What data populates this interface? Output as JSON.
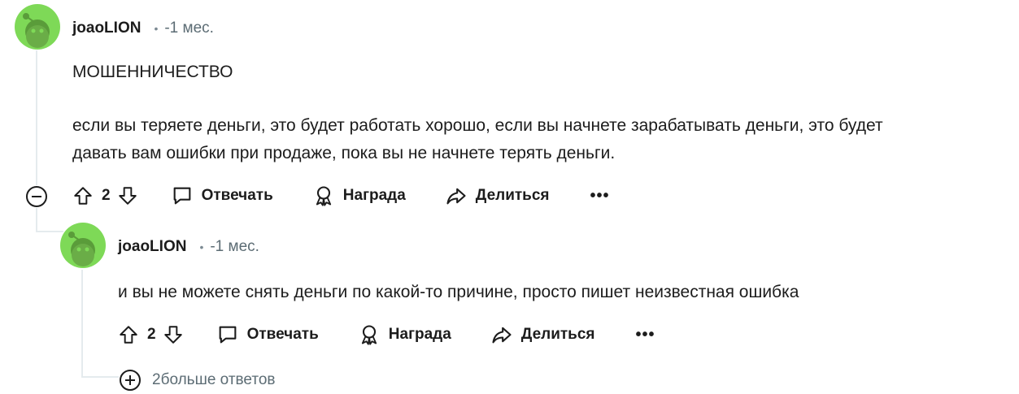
{
  "comments": [
    {
      "username": "joaoLION",
      "separator": "•",
      "time": "-1 мес.",
      "paragraphs": [
        "МОШЕННИЧЕСТВО",
        "если вы теряете деньги, это будет работать хорошо, если вы начнете зарабатывать деньги, это будет",
        "давать вам ошибки при продаже, пока вы не начнете терять деньги."
      ],
      "votes": "2",
      "actions": {
        "reply": "Отвечать",
        "award": "Награда",
        "share": "Делиться",
        "more": "•••"
      }
    },
    {
      "username": "joaoLION",
      "separator": "•",
      "time": "-1 мес.",
      "paragraphs": [
        "и вы не можете снять деньги по какой-то причине, просто пишет неизвестная ошибка"
      ],
      "votes": "2",
      "actions": {
        "reply": "Отвечать",
        "award": "Награда",
        "share": "Делиться",
        "more": "•••"
      }
    }
  ],
  "more_replies": "2больше ответов",
  "icons": {
    "upvote": "arrow-up-icon",
    "downvote": "arrow-down-icon",
    "reply": "speech-bubble-icon",
    "award": "award-ribbon-icon",
    "share": "share-arrow-icon",
    "collapse": "minus-circle-icon",
    "expand": "plus-circle-icon"
  },
  "colors": {
    "avatar": "#7ed957",
    "thread_line": "#e5ebee",
    "meta_text": "#5c6c74"
  }
}
